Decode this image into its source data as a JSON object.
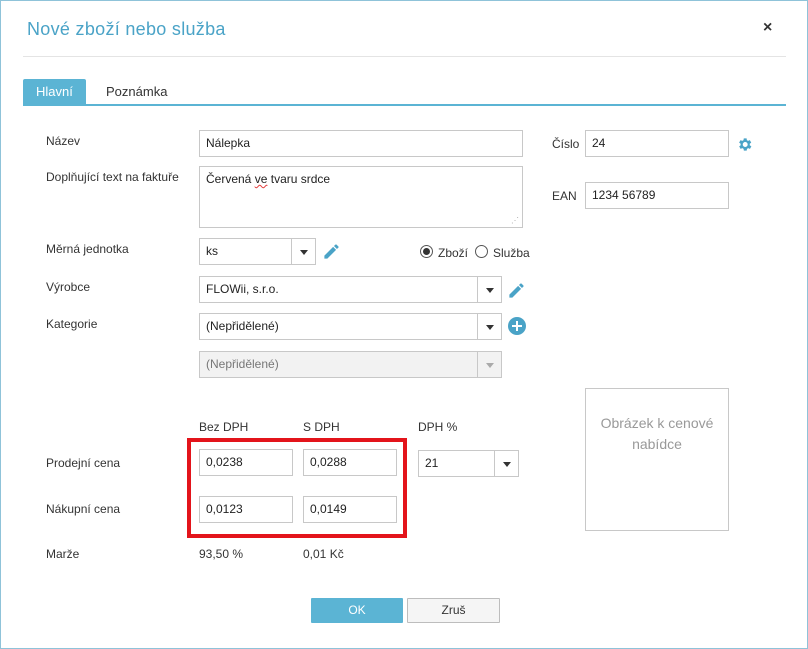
{
  "dialog": {
    "title": "Nové zboží nebo služba",
    "close": "×"
  },
  "tabs": [
    {
      "label": "Hlavní",
      "active": true
    },
    {
      "label": "Poznámka",
      "active": false
    }
  ],
  "form": {
    "name_label": "Název",
    "name_value": "Nálepka",
    "extra_text_label": "Doplňující text na faktuře",
    "extra_text_value_word1": "Červená",
    "extra_text_value_word2": "ve",
    "extra_text_value_word3": "tvaru srdce",
    "number_label": "Číslo",
    "number_value": "24",
    "ean_label": "EAN",
    "ean_value": "1234 56789",
    "unit_label": "Měrná jednotka",
    "unit_value": "ks",
    "type_goods_label": "Zboží",
    "type_service_label": "Služba",
    "type_selected": "Zboží",
    "manufacturer_label": "Výrobce",
    "manufacturer_value": "FLOWii, s.r.o.",
    "category_label": "Kategorie",
    "category_value": "(Nepřidělené)",
    "subcategory_value": "(Nepřidělené)",
    "image_placeholder": "Obrázek k cenové nabídce"
  },
  "prices": {
    "col_net": "Bez DPH",
    "col_gross": "S DPH",
    "col_vat": "DPH %",
    "sale_label": "Prodejní cena",
    "sale_net": "0,0238",
    "sale_gross": "0,0288",
    "vat_value": "21",
    "purchase_label": "Nákupní cena",
    "purchase_net": "0,0123",
    "purchase_gross": "0,0149",
    "margin_label": "Marže",
    "margin_percent": "93,50 %",
    "margin_amount": "0,01 Kč"
  },
  "buttons": {
    "ok": "OK",
    "cancel": "Zruš"
  },
  "colors": {
    "accent": "#5bb4d4",
    "title": "#4aa3c7",
    "highlight": "#e3141b"
  },
  "icons": {
    "edit": "pencil-icon",
    "settings": "gear-icon",
    "add": "plus-circle-icon",
    "dropdown": "chevron-down-icon"
  }
}
